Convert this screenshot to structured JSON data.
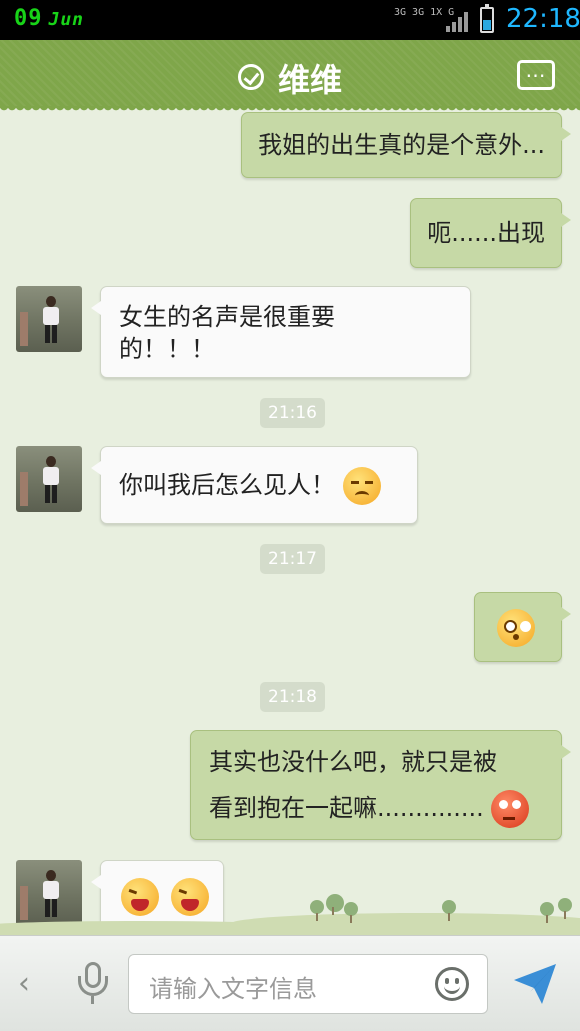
{
  "status_bar": {
    "date": "09",
    "month": "Jun",
    "network": "3G 3G 1X G",
    "time": "22:18",
    "battery_level": 0.35
  },
  "header": {
    "title": "维维",
    "verified_icon": "check-circle-icon",
    "menu_icon": "more-icon"
  },
  "messages": [
    {
      "direction": "out",
      "text": "我姐的出生真的是个意外..."
    },
    {
      "direction": "out",
      "text": "呃......出现"
    },
    {
      "direction": "in",
      "text": "女生的名声是很重要的！！！"
    },
    {
      "timestamp": "21:16"
    },
    {
      "direction": "in",
      "text": "你叫我后怎么见人！",
      "emoji": "crying-face"
    },
    {
      "timestamp": "21:17"
    },
    {
      "direction": "out",
      "emoji": "puzzled-face"
    },
    {
      "timestamp": "21:18"
    },
    {
      "direction": "out",
      "text_line1": "其实也没什么吧，就只是被",
      "text_line2": "看到抱在一起嘛..............",
      "emoji": "red-face"
    },
    {
      "direction": "in",
      "emoji": [
        "laughing-face",
        "laughing-face"
      ]
    }
  ],
  "input_bar": {
    "placeholder": "请输入文字信息",
    "back_icon": "chevron-left-icon",
    "voice_icon": "microphone-icon",
    "emoji_icon": "smiley-icon",
    "send_icon": "send-icon"
  },
  "colors": {
    "header": "#7fa64a",
    "outgoing_bubble": "#c6d9a6",
    "incoming_bubble": "#fafafa",
    "background": "#e8efdf",
    "time_accent": "#1fb8ff"
  }
}
